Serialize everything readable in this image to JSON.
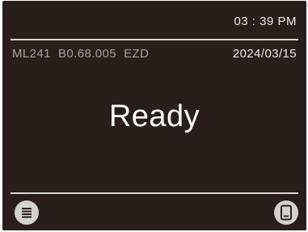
{
  "header": {
    "time": "03 : 39 PM"
  },
  "info_bar": {
    "model": "ML241  B0.68.005  EZD",
    "date": "2024/03/15"
  },
  "main": {
    "status": "Ready"
  },
  "footer": {
    "left_icon": "menu-icon",
    "right_icon": "device-icon"
  },
  "colors": {
    "background": "#2a1e1c",
    "text_primary": "#ffffff",
    "text_secondary": "#a7a39e",
    "divider": "#d9d6d2",
    "icon_button": "#d4d2cf"
  }
}
